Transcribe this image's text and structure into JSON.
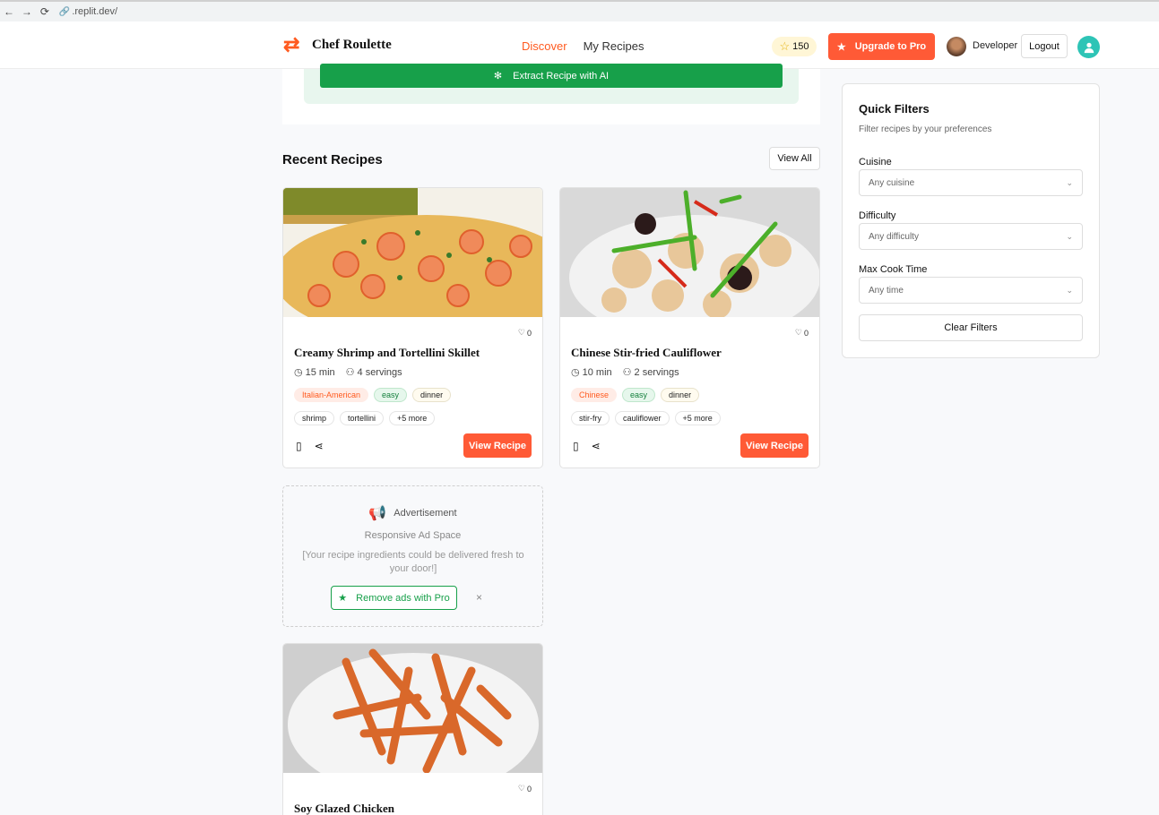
{
  "browser": {
    "url": ".replit.dev/"
  },
  "header": {
    "brand": "Chef Roulette",
    "nav": [
      {
        "label": "Discover",
        "active": true
      },
      {
        "label": "My Recipes",
        "active": false
      }
    ],
    "points": "150",
    "upgrade_label": "Upgrade to Pro",
    "user_name": "Developer",
    "logout_label": "Logout"
  },
  "extract": {
    "label": "Extract Recipe with AI"
  },
  "recent": {
    "title": "Recent Recipes",
    "view_all": "View All"
  },
  "recipes": [
    {
      "title": "Creamy Shrimp and Tortellini Skillet",
      "likes": "0",
      "time": "15 min",
      "servings": "4 servings",
      "cuisine": "Italian-American",
      "difficulty": "easy",
      "meal": "dinner",
      "ingredients": [
        "shrimp",
        "tortellini",
        "+5 more"
      ],
      "button": "View Recipe"
    },
    {
      "title": "Chinese Stir-fried Cauliflower",
      "likes": "0",
      "time": "10 min",
      "servings": "2 servings",
      "cuisine": "Chinese",
      "difficulty": "easy",
      "meal": "dinner",
      "ingredients": [
        "stir-fry",
        "cauliflower",
        "+5 more"
      ],
      "button": "View Recipe"
    },
    {
      "title": "Soy Glazed Chicken",
      "likes": "0"
    }
  ],
  "ad": {
    "label": "Advertisement",
    "subtitle": "Responsive Ad Space",
    "text": "[Your recipe ingredients could be delivered fresh to your door!]",
    "remove_label": "Remove ads with Pro",
    "close_symbol": "×"
  },
  "filters": {
    "title": "Quick Filters",
    "subtitle": "Filter recipes by your preferences",
    "cuisine_label": "Cuisine",
    "cuisine_value": "Any cuisine",
    "difficulty_label": "Difficulty",
    "difficulty_value": "Any difficulty",
    "time_label": "Max Cook Time",
    "time_value": "Any time",
    "clear_label": "Clear Filters"
  },
  "colors": {
    "accent": "#ff5a36",
    "green": "#17a04a",
    "teal": "#2ec4b6"
  }
}
